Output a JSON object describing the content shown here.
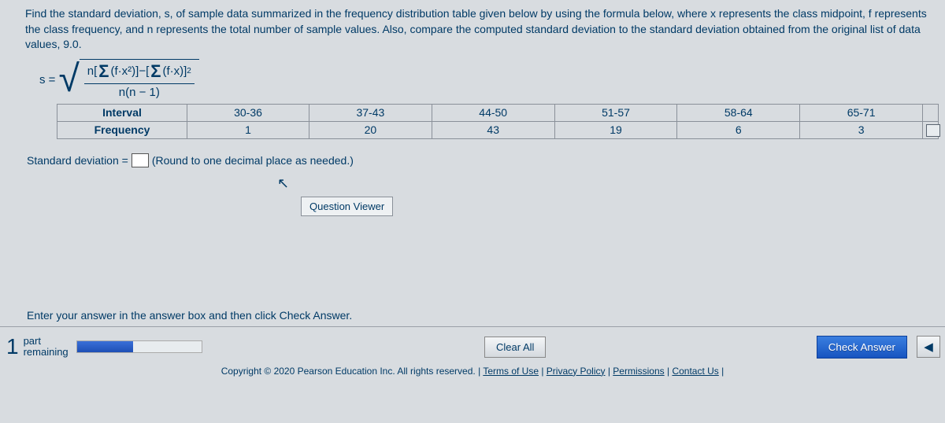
{
  "prompt": "Find the standard deviation, s, of sample data summarized in the frequency distribution table given below by using the formula below, where x represents the class midpoint, f represents the class frequency, and n represents the total number of sample values. Also, compare the computed standard deviation to the standard deviation obtained from the original list of data values, 9.0.",
  "formula": {
    "lhs": "s =",
    "num_a": "n",
    "num_b": "(f·x²)",
    "num_minus": " − ",
    "num_c": "(f·x)",
    "num_sq": "2",
    "den": "n(n − 1)"
  },
  "table": {
    "rowhdr1": "Interval",
    "rowhdr2": "Frequency",
    "intervals": [
      "30-36",
      "37-43",
      "44-50",
      "51-57",
      "58-64",
      "65-71"
    ],
    "freqs": [
      "1",
      "20",
      "43",
      "19",
      "6",
      "3"
    ]
  },
  "std_label_a": "Standard deviation =",
  "std_label_b": "(Round to one decimal place as needed.)",
  "qv": "Question Viewer",
  "instruct": "Enter your answer in the answer box and then click Check Answer.",
  "parts_num": "1",
  "parts_a": "part",
  "parts_b": "remaining",
  "clear": "Clear All",
  "check": "Check Answer",
  "copyright_a": "Copyright © 2020 Pearson Education Inc. All rights reserved. |",
  "copyright_b": "Terms of Use",
  "copyright_c": "Privacy Policy",
  "copyright_d": "Permissions",
  "copyright_e": "Contact Us",
  "pipe": " | "
}
